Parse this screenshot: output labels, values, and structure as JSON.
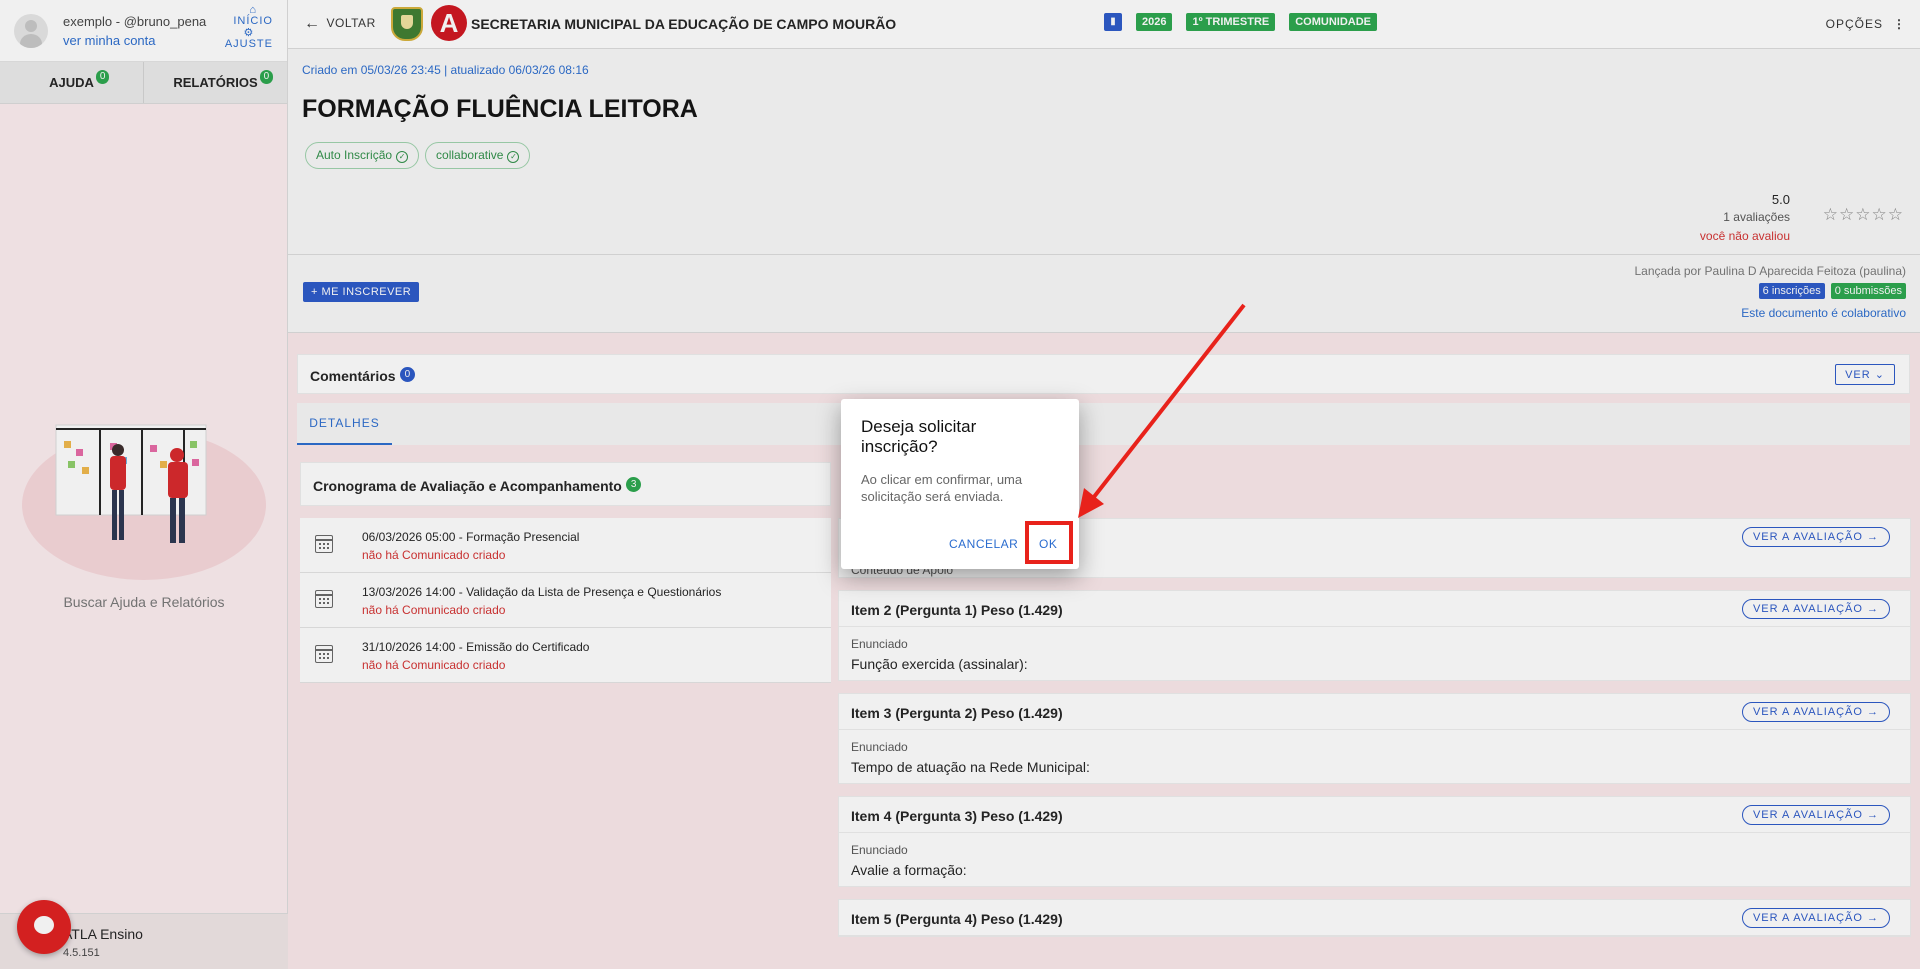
{
  "sidebar": {
    "username": "exemplo - @bruno_pena",
    "account_link": "ver minha conta",
    "home_link": "INÍCIO",
    "settings_link": "AJUSTE",
    "tabs": [
      {
        "label": "AJUDA",
        "count": "0"
      },
      {
        "label": "RELATÓRIOS",
        "count": "0"
      }
    ],
    "help_text": "Buscar Ajuda e Relatórios",
    "app_name": "ATLA Ensino",
    "version": "4.5.151"
  },
  "topbar": {
    "back_label": "VOLTAR",
    "org_title": "SECRETARIA MUNICIPAL DA EDUCAÇÃO DE CAMPO MOURÃO",
    "logo_letter": "A",
    "badges": [
      "2026",
      "1º TRIMESTRE",
      "COMUNIDADE"
    ],
    "options_label": "OPÇÕES"
  },
  "activity": {
    "meta": "Criado em 05/03/26 23:45 | atualizado 06/03/26 08:16",
    "title": "FORMAÇÃO FLUÊNCIA LEITORA",
    "chips": [
      "Auto Inscrição",
      "collaborative"
    ],
    "rating": "5.0",
    "rating_count": "1 avaliações",
    "rating_me": "você não avaliou",
    "stars": "☆☆☆☆☆",
    "enroll_button": "+ ME INSCREVER",
    "launched_by": "Lançada por Paulina D Aparecida Feitoza (paulina)",
    "enrollments": "6 inscrições",
    "submissions": "0 submissões",
    "collab_link": "Este documento é colaborativo"
  },
  "comments": {
    "title": "Comentários",
    "count": "0",
    "toggle": "VER"
  },
  "tabs": {
    "details": "DETALHES"
  },
  "schedule": {
    "title": "Cronograma de Avaliação e Acompanhamento",
    "count": "3",
    "items": [
      {
        "title": "06/03/2026 05:00 - Formação Presencial",
        "status": "não há Comunicado criado"
      },
      {
        "title": "13/03/2026 14:00 - Validação da Lista de Presença e Questionários",
        "status": "não há Comunicado criado"
      },
      {
        "title": "31/10/2026 14:00 - Emissão do Certificado",
        "status": "não há Comunicado criado"
      }
    ]
  },
  "evaluation_items": [
    {
      "head": "",
      "label": "Conteúdo de Apoio",
      "text": "",
      "button": "VER A AVALIAÇÃO"
    },
    {
      "head": "Item 2 (Pergunta 1) Peso (1.429)",
      "label": "Enunciado",
      "text": "Função exercida (assinalar):",
      "button": "VER A AVALIAÇÃO"
    },
    {
      "head": "Item 3 (Pergunta 2) Peso (1.429)",
      "label": "Enunciado",
      "text": "Tempo de atuação na Rede Municipal:",
      "button": "VER A AVALIAÇÃO"
    },
    {
      "head": "Item 4 (Pergunta 3) Peso (1.429)",
      "label": "Enunciado",
      "text": "Avalie a formação:",
      "button": "VER A AVALIAÇÃO"
    },
    {
      "head": "Item 5 (Pergunta 4) Peso (1.429)",
      "label": "",
      "text": "",
      "button": "VER A AVALIAÇÃO"
    }
  ],
  "dialog": {
    "title": "Deseja solicitar inscrição?",
    "text": "Ao clicar em confirmar, uma solicitação será enviada.",
    "cancel": "CANCELAR",
    "ok": "OK"
  },
  "colors": {
    "primary": "#2a58c9",
    "success": "#2aa64c",
    "danger": "#d43030",
    "annotation": "#e8221b"
  }
}
